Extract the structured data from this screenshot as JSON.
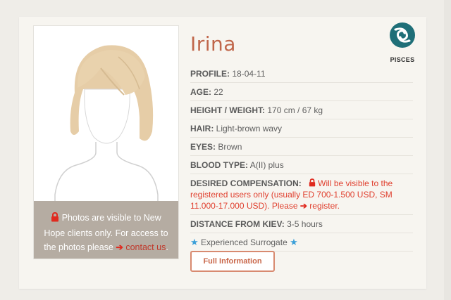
{
  "profile": {
    "name": "Irina",
    "zodiac": {
      "label": "PISCES",
      "icon": "pisces-icon"
    },
    "photo_notice": {
      "text_before": "Photos are visible to New Hope clients only. For access to the photos please",
      "arrow": "➔",
      "link": "contact us",
      "text_after": "."
    },
    "rows": {
      "profile": {
        "label": "PROFILE:",
        "value": "18-04-11"
      },
      "age": {
        "label": "AGE:",
        "value": "22"
      },
      "height_weight": {
        "label": "HEIGHT / WEIGHT:",
        "value": "170 cm / 67 kg"
      },
      "hair": {
        "label": "HAIR:",
        "value": "Light-brown wavy"
      },
      "eyes": {
        "label": "EYES:",
        "value": "Brown"
      },
      "blood_type": {
        "label": "BLOOD TYPE:",
        "value": "A(II) plus"
      },
      "compensation": {
        "label": "DESIRED COMPENSATION:",
        "text": "Will be visible to the registered users only (usually ED 700-1.500 USD, SM 11.000-17.000 USD). Please",
        "arrow": "➔",
        "link": "register."
      },
      "distance": {
        "label": "DISTANCE FROM KIEV:",
        "value": "3-5 hours"
      },
      "experienced": {
        "star": "★",
        "text": "Experienced Surrogate"
      }
    },
    "button_label": "Full Information"
  },
  "colors": {
    "accent": "#c0664a",
    "notice_red": "#e0402f",
    "star_blue": "#3a9fd8",
    "overlay_bg": "#b5aca2",
    "zodiac_teal": "#1f6f78",
    "hair": "#e6cda7"
  }
}
